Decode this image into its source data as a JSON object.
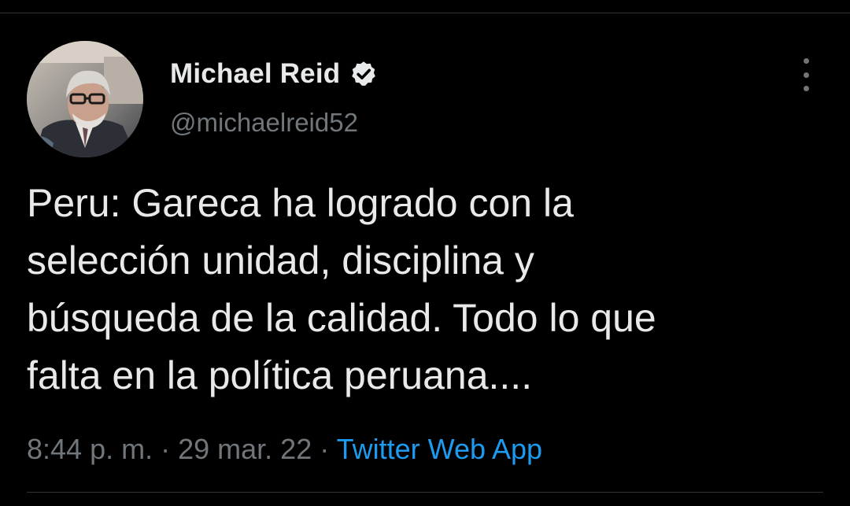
{
  "author": {
    "display_name": "Michael Reid",
    "handle": "@michaelreid52",
    "verified": true,
    "avatar_icon": "profile-photo"
  },
  "tweet": {
    "text_lines": [
      "Peru: Gareca ha logrado con la",
      "selección unidad, disciplina y",
      "búsqueda de la calidad. Todo lo que",
      "falta en la política peruana...."
    ],
    "time": "8:44 p. m.",
    "separator": "·",
    "date": "29 mar. 22",
    "source": "Twitter Web App"
  },
  "colors": {
    "background": "#000000",
    "primary_text": "#e7e9ea",
    "secondary_text": "#71767b",
    "link": "#1d9bf0",
    "divider": "#2f3336"
  },
  "icons": {
    "verified": "verified-badge-icon",
    "more": "more-options-icon"
  }
}
